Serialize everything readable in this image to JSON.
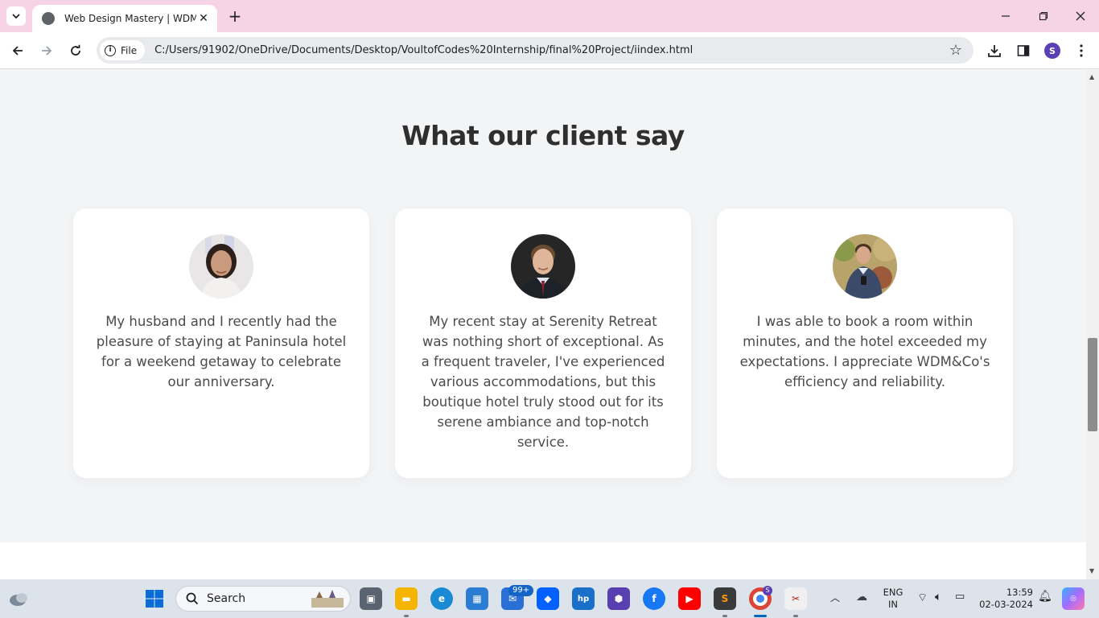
{
  "browser": {
    "tab_title": "Web Design Mastery | WDM&Co",
    "site_chip": "File",
    "url": "C:/Users/91902/OneDrive/Documents/Desktop/VoultofCodes%20Internship/final%20Project/iindex.html",
    "profile_initial": "S"
  },
  "section": {
    "title": "What our client say"
  },
  "testimonials": [
    {
      "quote": "My husband and I recently had the pleasure of staying at Paninsula hotel for a weekend getaway to celebrate our anniversary."
    },
    {
      "quote": "My recent stay at Serenity Retreat was nothing short of exceptional. As a frequent traveler, I've experienced various accommodations, but this boutique hotel truly stood out for its serene ambiance and top-notch service."
    },
    {
      "quote": "I was able to book a room within minutes, and the hotel exceeded my expectations. I appreciate WDM&Co's efficiency and reliability."
    }
  ],
  "taskbar": {
    "search_label": "Search",
    "mail_badge": "99+",
    "lang_line1": "ENG",
    "lang_line2": "IN",
    "time": "13:59",
    "date": "02-03-2024",
    "chrome_badge": "S"
  },
  "colors": {
    "tabbar_bg": "#f6d3e6",
    "page_bg": "#f3f4f6",
    "card_bg": "#ffffff",
    "title_color": "#2f2f2f",
    "text_color": "#4b4b4b"
  }
}
